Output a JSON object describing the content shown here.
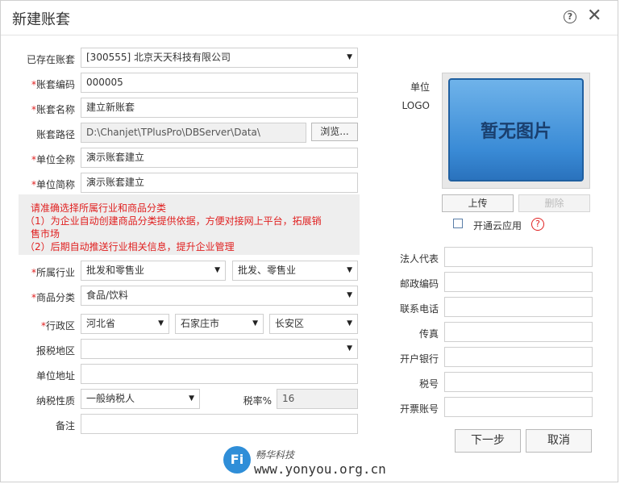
{
  "dialog": {
    "title": "新建账套",
    "help_icon": "?",
    "close_icon": "✕"
  },
  "form": {
    "existing_label": "已存在账套",
    "existing_value": "[300555] 北京天天科技有限公司",
    "code_label": "账套编码",
    "code_value": "000005",
    "name_label": "账套名称",
    "name_value": "建立新账套",
    "path_label": "账套路径",
    "path_value": "D:\\Chanjet\\TPlusPro\\DBServer\\Data\\",
    "browse_label": "浏览...",
    "fullname_label": "单位全称",
    "fullname_value": "演示账套建立",
    "shortname_label": "单位简称",
    "shortname_value": "演示账套建立",
    "notice": {
      "line1": "请准确选择所属行业和商品分类",
      "line2": "（1）为企业自动创建商品分类提供依据，方便对接网上平台，拓展销",
      "line3": "售市场",
      "line4": "（2）后期自动推送行业相关信息，提升企业管理"
    },
    "industry_label": "所属行业",
    "industry_value1": "批发和零售业",
    "industry_value2": "批发、零售业",
    "category_label": "商品分类",
    "category_value": "食品/饮料",
    "region_label": "行政区",
    "province": "河北省",
    "city": "石家庄市",
    "district": "长安区",
    "tax_region_label": "报税地区",
    "tax_region_value": "",
    "address_label": "单位地址",
    "address_value": "",
    "tax_nature_label": "纳税性质",
    "tax_nature_value": "一般纳税人",
    "tax_rate_label": "税率%",
    "tax_rate_value": "16",
    "remark_label": "备注",
    "remark_value": ""
  },
  "right": {
    "unit_label": "单位",
    "logo_label": "LOGO",
    "logo_placeholder": "暂无图片",
    "upload_label": "上传",
    "delete_label": "删除",
    "cloud_label": "开通云应用",
    "cloud_help": "?",
    "legal_label": "法人代表",
    "postal_label": "邮政编码",
    "phone_label": "联系电话",
    "fax_label": "传真",
    "bank_label": "开户银行",
    "taxno_label": "税号",
    "account_label": "开票账号"
  },
  "footer": {
    "next_label": "下一步",
    "cancel_label": "取消"
  },
  "watermark": {
    "logo_text": "Fi",
    "line1": "畅华科技",
    "line2": "www.yonyou.org.cn"
  }
}
